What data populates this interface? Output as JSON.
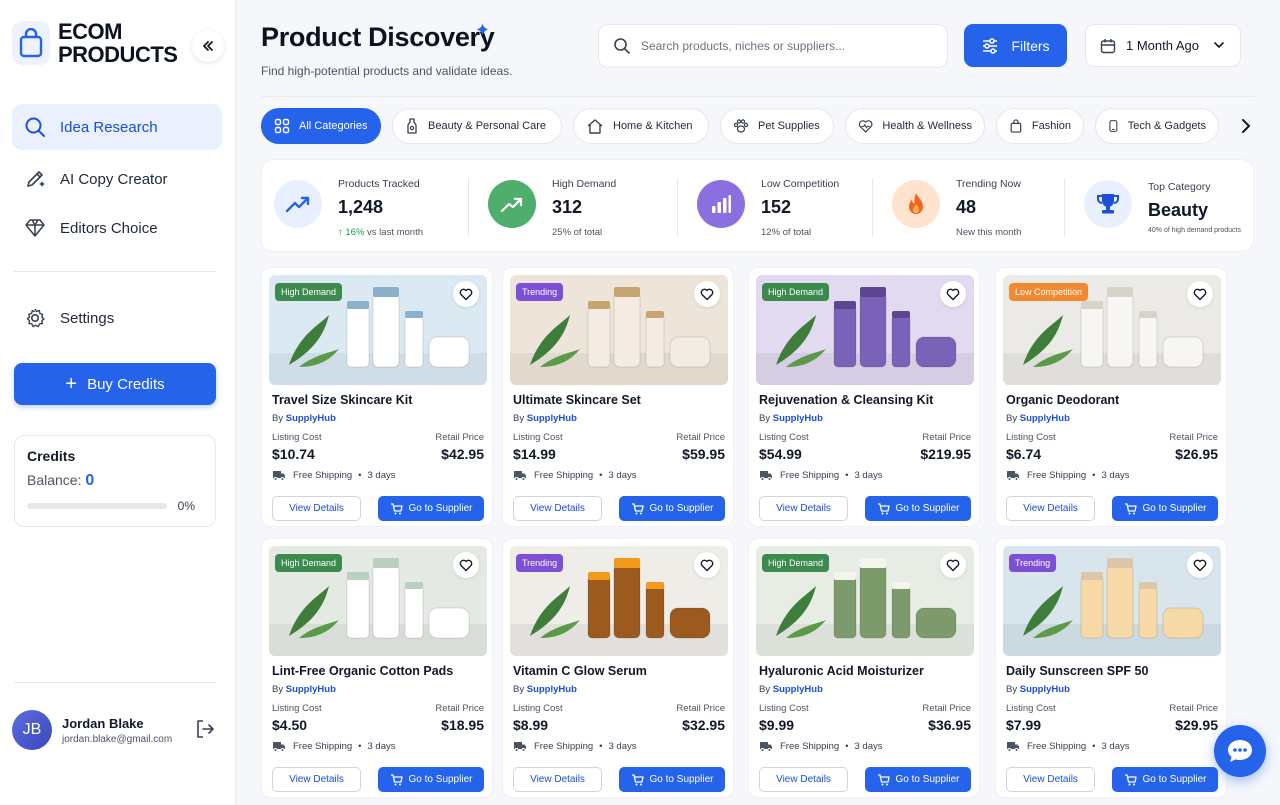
{
  "brand": {
    "line1": "ECOM",
    "line2": "PRODUCTS"
  },
  "sidebar": {
    "items": [
      {
        "label": "Idea Research",
        "icon": "search-icon",
        "active": true
      },
      {
        "label": "AI Copy Creator",
        "icon": "pen-sparkle-icon"
      },
      {
        "label": "Editors Choice",
        "icon": "diamond-icon"
      },
      {
        "label": "Settings",
        "icon": "gear-icon"
      }
    ],
    "buy_credits": "Buy Credits",
    "credits": {
      "title": "Credits",
      "balance_label": "Balance:",
      "balance": "0",
      "progress_pct": 0,
      "progress_text": "0%"
    },
    "user": {
      "initials": "JB",
      "name": "Jordan Blake",
      "email": "jordan.blake@gmail.com"
    }
  },
  "header": {
    "title": "Product Discovery",
    "subtitle": "Find high-potential products and validate ideas.",
    "search_placeholder": "Search products, niches or suppliers...",
    "filters_label": "Filters",
    "date_range": "1 Month Ago"
  },
  "categories": [
    {
      "label": "All Categories",
      "icon": "grid-icon",
      "active": true
    },
    {
      "label": "Beauty & Personal Care",
      "icon": "bottle-icon"
    },
    {
      "label": "Home & Kitchen",
      "icon": "home-icon"
    },
    {
      "label": "Pet Supplies",
      "icon": "paw-icon"
    },
    {
      "label": "Health & Wellness",
      "icon": "heart-pulse-icon"
    },
    {
      "label": "Fashion",
      "icon": "bag-icon"
    },
    {
      "label": "Tech & Gadgets",
      "icon": "phone-icon"
    }
  ],
  "stats": [
    {
      "label": "Products Tracked",
      "value": "1,248",
      "delta": "16%",
      "sub": "vs last month",
      "icon": "trend-up-icon",
      "color": "#2563eb",
      "bg": "#e8efff"
    },
    {
      "label": "High Demand",
      "value": "312",
      "sub": "25% of total",
      "icon": "chart-up-icon",
      "color": "#ffffff",
      "bg": "#4fae6b"
    },
    {
      "label": "Low Competition",
      "value": "152",
      "sub": "12% of total",
      "icon": "bars-icon",
      "color": "#ffffff",
      "bg": "#8b6fe0"
    },
    {
      "label": "Trending Now",
      "value": "48",
      "sub": "New this month",
      "icon": "flame-icon",
      "color": "#f15a24",
      "bg": "#ffe3cf"
    },
    {
      "label": "Top Category",
      "value": "Beauty",
      "sub": "40% of high demand products",
      "icon": "trophy-icon",
      "color": "#1d4ed8",
      "bg": "#e8efff"
    }
  ],
  "product_labels": {
    "by": "By",
    "listing_cost": "Listing Cost",
    "retail_price": "Retail Price",
    "shipping": "Free Shipping",
    "view_details": "View Details",
    "go_to_supplier": "Go to Supplier"
  },
  "products": [
    {
      "name": "Travel Size Skincare Kit",
      "supplier": "SupplyHub",
      "cost": "$10.74",
      "retail": "$42.95",
      "days": "3 days",
      "badge": "High Demand",
      "badge_color": "#3d8a4e",
      "img_bg": "#dbe9f3",
      "item_color": "#ffffff",
      "accent": "#8bb0cc"
    },
    {
      "name": "Ultimate Skincare Set",
      "supplier": "SupplyHub",
      "cost": "$14.99",
      "retail": "$59.95",
      "days": "3 days",
      "badge": "Trending",
      "badge_color": "#7c4fd6",
      "img_bg": "#eee5da",
      "item_color": "#f4ece2",
      "accent": "#c7a470"
    },
    {
      "name": "Rejuvenation & Cleansing Kit",
      "supplier": "SupplyHub",
      "cost": "$54.99",
      "retail": "$219.95",
      "days": "3 days",
      "badge": "High Demand",
      "badge_color": "#3d8a4e",
      "img_bg": "#e1daf0",
      "item_color": "#7a62b8",
      "accent": "#5c468f"
    },
    {
      "name": "Organic Deodorant",
      "supplier": "SupplyHub",
      "cost": "$6.74",
      "retail": "$26.95",
      "days": "3 days",
      "badge": "Low Competition",
      "badge_color": "#f0892f",
      "img_bg": "#ebeae6",
      "item_color": "#f7f6f2",
      "accent": "#d8d3c7"
    },
    {
      "name": "Lint-Free Organic Cotton Pads",
      "supplier": "SupplyHub",
      "cost": "$4.50",
      "retail": "$18.95",
      "days": "3 days",
      "badge": "High Demand",
      "badge_color": "#3d8a4e",
      "img_bg": "#e4e9e4",
      "item_color": "#ffffff",
      "accent": "#b9cfc0"
    },
    {
      "name": "Vitamin C Glow Serum",
      "supplier": "SupplyHub",
      "cost": "$8.99",
      "retail": "$32.95",
      "days": "3 days",
      "badge": "Trending",
      "badge_color": "#7c4fd6",
      "img_bg": "#efede8",
      "item_color": "#9c5a1f",
      "accent": "#f39a1d"
    },
    {
      "name": "Hyaluronic Acid Moisturizer",
      "supplier": "SupplyHub",
      "cost": "$9.99",
      "retail": "$36.95",
      "days": "3 days",
      "badge": "High Demand",
      "badge_color": "#3d8a4e",
      "img_bg": "#e7ece4",
      "item_color": "#7c9a6a",
      "accent": "#f5f5ef"
    },
    {
      "name": "Daily Sunscreen SPF 50",
      "supplier": "SupplyHub",
      "cost": "$7.99",
      "retail": "$29.95",
      "days": "3 days",
      "badge": "Trending",
      "badge_color": "#7c4fd6",
      "img_bg": "#d9e5ec",
      "item_color": "#f6d9a6",
      "accent": "#d9c7a8"
    }
  ]
}
